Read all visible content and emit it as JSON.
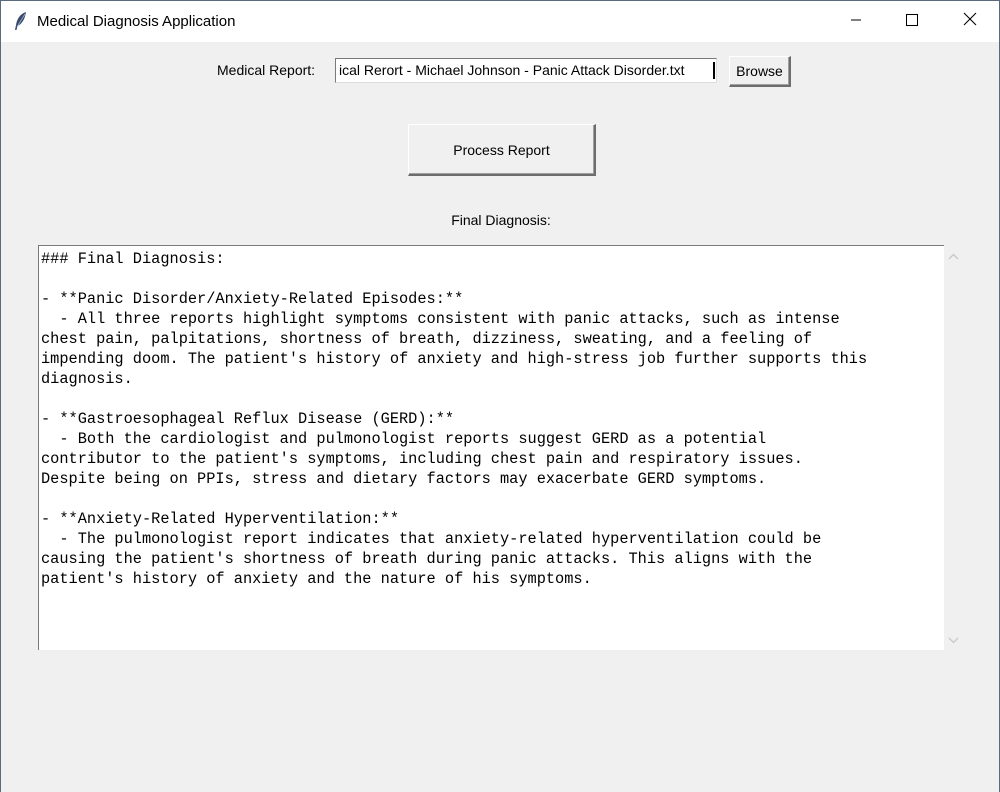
{
  "window": {
    "title": "Medical Diagnosis Application",
    "icon": "feather-icon"
  },
  "form": {
    "report_label": "Medical Report:",
    "report_value": "ical Rerort - Michael Johnson - Panic Attack Disorder.txt",
    "browse_label": "Browse",
    "process_label": "Process Report",
    "final_label": "Final Diagnosis:"
  },
  "diagnosis": {
    "text": "### Final Diagnosis:\n\n- **Panic Disorder/Anxiety-Related Episodes:**\n  - All three reports highlight symptoms consistent with panic attacks, such as intense\nchest pain, palpitations, shortness of breath, dizziness, sweating, and a feeling of\nimpending doom. The patient's history of anxiety and high-stress job further supports this\ndiagnosis.\n\n- **Gastroesophageal Reflux Disease (GERD):**\n  - Both the cardiologist and pulmonologist reports suggest GERD as a potential\ncontributor to the patient's symptoms, including chest pain and respiratory issues.\nDespite being on PPIs, stress and dietary factors may exacerbate GERD symptoms.\n\n- **Anxiety-Related Hyperventilation:**\n  - The pulmonologist report indicates that anxiety-related hyperventilation could be\ncausing the patient's shortness of breath during panic attacks. This aligns with the\npatient's history of anxiety and the nature of his symptoms."
  },
  "colors": {
    "window_bg": "#f0f0f0",
    "titlebar_bg": "#ffffff",
    "text_bg": "#ffffff"
  }
}
